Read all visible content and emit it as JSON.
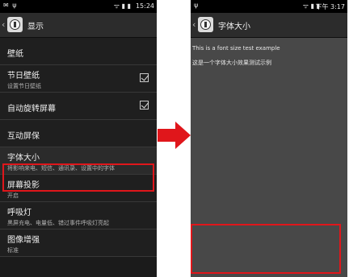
{
  "left_screen": {
    "status_bar": {
      "left_icons": "✉ ψ",
      "right_icons": "ᯤ ▮ ▮",
      "time": "15:24"
    },
    "action_bar": {
      "back": "‹",
      "title": "显示"
    },
    "items": [
      {
        "label": "壁纸",
        "sub": ""
      },
      {
        "label": "节日壁纸",
        "sub": "设置节日壁纸",
        "checkbox": true
      },
      {
        "label": "自动旋转屏幕",
        "sub": "",
        "checkbox": true
      },
      {
        "label": "互动屏保",
        "sub": ""
      },
      {
        "label": "字体大小",
        "sub": "将影响来电、短信、通讯录、设置中的字体",
        "highlighted": true
      },
      {
        "label": "屏幕投影",
        "sub": "开启"
      },
      {
        "label": "呼吸灯",
        "sub": "黑屏充电、电量低、错过事件呼吸灯亮起"
      },
      {
        "label": "图像增强",
        "sub": "标准"
      }
    ]
  },
  "right_screen": {
    "status_bar": {
      "left_icons": "ψ",
      "right_icons": "ᯤ ▮ ▮",
      "time": "下午 3:17"
    },
    "action_bar": {
      "back": "‹",
      "title": "字体大小"
    },
    "preview": {
      "line1": "This is a font size test example",
      "line2": "这是一个字体大小效果测试示例"
    }
  },
  "colors": {
    "highlight": "#e0161b",
    "arrow": "#e0161b"
  }
}
